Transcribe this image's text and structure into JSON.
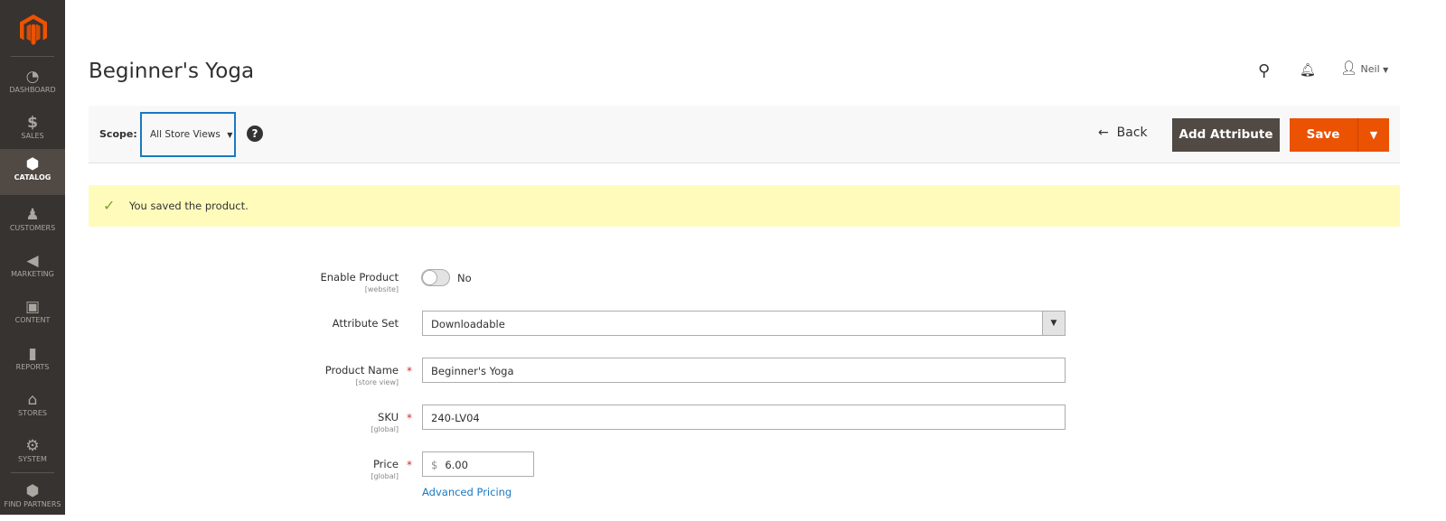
{
  "sidebar": {
    "items": [
      {
        "label": "DASHBOARD",
        "icon": "dashboard-gauge-icon"
      },
      {
        "label": "SALES",
        "icon": "dollar-icon"
      },
      {
        "label": "CATALOG",
        "icon": "box-icon",
        "active": true
      },
      {
        "label": "CUSTOMERS",
        "icon": "person-icon"
      },
      {
        "label": "MARKETING",
        "icon": "megaphone-icon"
      },
      {
        "label": "CONTENT",
        "icon": "layout-icon"
      },
      {
        "label": "REPORTS",
        "icon": "bar-chart-icon"
      },
      {
        "label": "STORES",
        "icon": "store-icon"
      },
      {
        "label": "SYSTEM",
        "icon": "gear-icon"
      },
      {
        "label": "FIND PARTNERS",
        "icon": "blocks-icon"
      }
    ]
  },
  "header": {
    "title": "Beginner's Yoga",
    "user": "Neil"
  },
  "toolbar": {
    "scope_label": "Scope:",
    "scope_value": "All Store Views",
    "help": "?",
    "back": "Back",
    "add_attribute": "Add Attribute",
    "save": "Save"
  },
  "message": {
    "text": "You saved the product.",
    "color": "#fffbbb"
  },
  "form": {
    "enable_product": {
      "label": "Enable Product",
      "scope": "[website]",
      "value": "No",
      "enabled": false
    },
    "attribute_set": {
      "label": "Attribute Set",
      "value": "Downloadable"
    },
    "product_name": {
      "label": "Product Name",
      "scope": "[store view]",
      "value": "Beginner's Yoga",
      "required": "*"
    },
    "sku": {
      "label": "SKU",
      "scope": "[global]",
      "value": "240-LV04",
      "required": "*"
    },
    "price": {
      "label": "Price",
      "scope": "[global]",
      "currency": "$",
      "value": "6.00",
      "required": "*",
      "advanced_link": "Advanced Pricing"
    }
  },
  "colors": {
    "accent": "#eb5202",
    "sidebar": "#373330",
    "focus": "#1979c3"
  }
}
